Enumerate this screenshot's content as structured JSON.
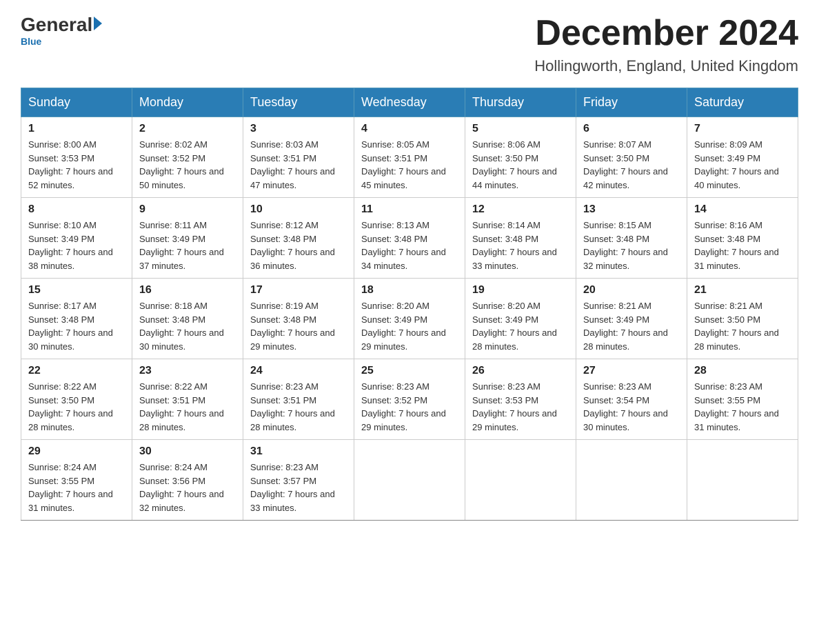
{
  "header": {
    "logo": {
      "general": "General",
      "blue": "Blue"
    },
    "title": "December 2024",
    "subtitle": "Hollingworth, England, United Kingdom"
  },
  "days_of_week": [
    "Sunday",
    "Monday",
    "Tuesday",
    "Wednesday",
    "Thursday",
    "Friday",
    "Saturday"
  ],
  "weeks": [
    [
      {
        "date": "1",
        "sunrise": "8:00 AM",
        "sunset": "3:53 PM",
        "daylight": "7 hours and 52 minutes."
      },
      {
        "date": "2",
        "sunrise": "8:02 AM",
        "sunset": "3:52 PM",
        "daylight": "7 hours and 50 minutes."
      },
      {
        "date": "3",
        "sunrise": "8:03 AM",
        "sunset": "3:51 PM",
        "daylight": "7 hours and 47 minutes."
      },
      {
        "date": "4",
        "sunrise": "8:05 AM",
        "sunset": "3:51 PM",
        "daylight": "7 hours and 45 minutes."
      },
      {
        "date": "5",
        "sunrise": "8:06 AM",
        "sunset": "3:50 PM",
        "daylight": "7 hours and 44 minutes."
      },
      {
        "date": "6",
        "sunrise": "8:07 AM",
        "sunset": "3:50 PM",
        "daylight": "7 hours and 42 minutes."
      },
      {
        "date": "7",
        "sunrise": "8:09 AM",
        "sunset": "3:49 PM",
        "daylight": "7 hours and 40 minutes."
      }
    ],
    [
      {
        "date": "8",
        "sunrise": "8:10 AM",
        "sunset": "3:49 PM",
        "daylight": "7 hours and 38 minutes."
      },
      {
        "date": "9",
        "sunrise": "8:11 AM",
        "sunset": "3:49 PM",
        "daylight": "7 hours and 37 minutes."
      },
      {
        "date": "10",
        "sunrise": "8:12 AM",
        "sunset": "3:48 PM",
        "daylight": "7 hours and 36 minutes."
      },
      {
        "date": "11",
        "sunrise": "8:13 AM",
        "sunset": "3:48 PM",
        "daylight": "7 hours and 34 minutes."
      },
      {
        "date": "12",
        "sunrise": "8:14 AM",
        "sunset": "3:48 PM",
        "daylight": "7 hours and 33 minutes."
      },
      {
        "date": "13",
        "sunrise": "8:15 AM",
        "sunset": "3:48 PM",
        "daylight": "7 hours and 32 minutes."
      },
      {
        "date": "14",
        "sunrise": "8:16 AM",
        "sunset": "3:48 PM",
        "daylight": "7 hours and 31 minutes."
      }
    ],
    [
      {
        "date": "15",
        "sunrise": "8:17 AM",
        "sunset": "3:48 PM",
        "daylight": "7 hours and 30 minutes."
      },
      {
        "date": "16",
        "sunrise": "8:18 AM",
        "sunset": "3:48 PM",
        "daylight": "7 hours and 30 minutes."
      },
      {
        "date": "17",
        "sunrise": "8:19 AM",
        "sunset": "3:48 PM",
        "daylight": "7 hours and 29 minutes."
      },
      {
        "date": "18",
        "sunrise": "8:20 AM",
        "sunset": "3:49 PM",
        "daylight": "7 hours and 29 minutes."
      },
      {
        "date": "19",
        "sunrise": "8:20 AM",
        "sunset": "3:49 PM",
        "daylight": "7 hours and 28 minutes."
      },
      {
        "date": "20",
        "sunrise": "8:21 AM",
        "sunset": "3:49 PM",
        "daylight": "7 hours and 28 minutes."
      },
      {
        "date": "21",
        "sunrise": "8:21 AM",
        "sunset": "3:50 PM",
        "daylight": "7 hours and 28 minutes."
      }
    ],
    [
      {
        "date": "22",
        "sunrise": "8:22 AM",
        "sunset": "3:50 PM",
        "daylight": "7 hours and 28 minutes."
      },
      {
        "date": "23",
        "sunrise": "8:22 AM",
        "sunset": "3:51 PM",
        "daylight": "7 hours and 28 minutes."
      },
      {
        "date": "24",
        "sunrise": "8:23 AM",
        "sunset": "3:51 PM",
        "daylight": "7 hours and 28 minutes."
      },
      {
        "date": "25",
        "sunrise": "8:23 AM",
        "sunset": "3:52 PM",
        "daylight": "7 hours and 29 minutes."
      },
      {
        "date": "26",
        "sunrise": "8:23 AM",
        "sunset": "3:53 PM",
        "daylight": "7 hours and 29 minutes."
      },
      {
        "date": "27",
        "sunrise": "8:23 AM",
        "sunset": "3:54 PM",
        "daylight": "7 hours and 30 minutes."
      },
      {
        "date": "28",
        "sunrise": "8:23 AM",
        "sunset": "3:55 PM",
        "daylight": "7 hours and 31 minutes."
      }
    ],
    [
      {
        "date": "29",
        "sunrise": "8:24 AM",
        "sunset": "3:55 PM",
        "daylight": "7 hours and 31 minutes."
      },
      {
        "date": "30",
        "sunrise": "8:24 AM",
        "sunset": "3:56 PM",
        "daylight": "7 hours and 32 minutes."
      },
      {
        "date": "31",
        "sunrise": "8:23 AM",
        "sunset": "3:57 PM",
        "daylight": "7 hours and 33 minutes."
      },
      null,
      null,
      null,
      null
    ]
  ]
}
